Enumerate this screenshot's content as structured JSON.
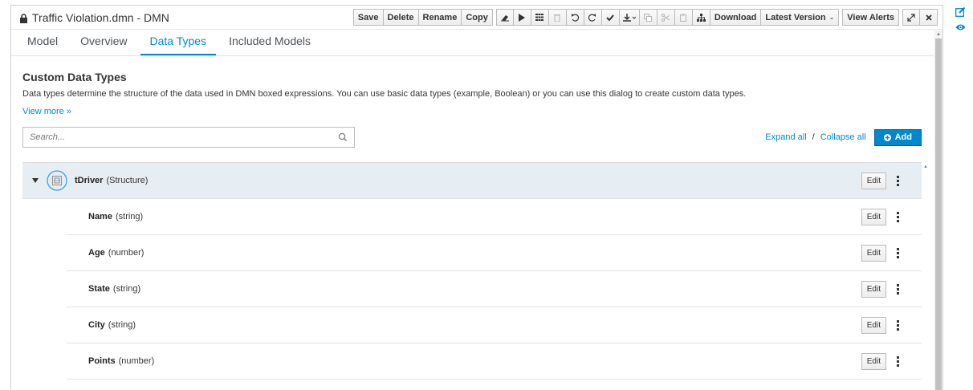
{
  "window": {
    "title": "Traffic Violation.dmn - DMN"
  },
  "toolbar": {
    "save": "Save",
    "delete": "Delete",
    "rename": "Rename",
    "copy": "Copy",
    "download": "Download",
    "latest_version": "Latest Version",
    "view_alerts": "View Alerts"
  },
  "tabs": [
    {
      "label": "Model",
      "active": false
    },
    {
      "label": "Overview",
      "active": false
    },
    {
      "label": "Data Types",
      "active": true
    },
    {
      "label": "Included Models",
      "active": false
    }
  ],
  "content": {
    "title": "Custom Data Types",
    "description": "Data types determine the structure of the data used in DMN boxed expressions. You can use basic data types (example, Boolean) or you can use this dialog to create custom data types.",
    "view_more": "View more »",
    "search_placeholder": "Search...",
    "expand_all": "Expand all",
    "separator": "/",
    "collapse_all": "Collapse all",
    "add": "Add"
  },
  "data_types": [
    {
      "name": "tDriver",
      "type": "(Structure)",
      "edit": "Edit"
    },
    {
      "name": "Name",
      "type": "(string)",
      "edit": "Edit"
    },
    {
      "name": "Age",
      "type": "(number)",
      "edit": "Edit"
    },
    {
      "name": "State",
      "type": "(string)",
      "edit": "Edit"
    },
    {
      "name": "City",
      "type": "(string)",
      "edit": "Edit"
    },
    {
      "name": "Points",
      "type": "(number)",
      "edit": "Edit"
    }
  ],
  "colors": {
    "accent": "#0088ce",
    "parent_row_bg": "#e7eef3"
  },
  "icons": [
    "lock-icon",
    "eraser-icon",
    "play-icon",
    "grid-icon",
    "trash-icon",
    "undo-icon",
    "redo-icon",
    "check-icon",
    "download-icon",
    "copy-icon",
    "cut-icon",
    "paste-icon",
    "hierarchy-icon",
    "expand-icon",
    "close-icon",
    "search-icon",
    "plus-circle-icon",
    "structure-icon",
    "edit-icon",
    "eye-icon",
    "kebab-icon"
  ]
}
